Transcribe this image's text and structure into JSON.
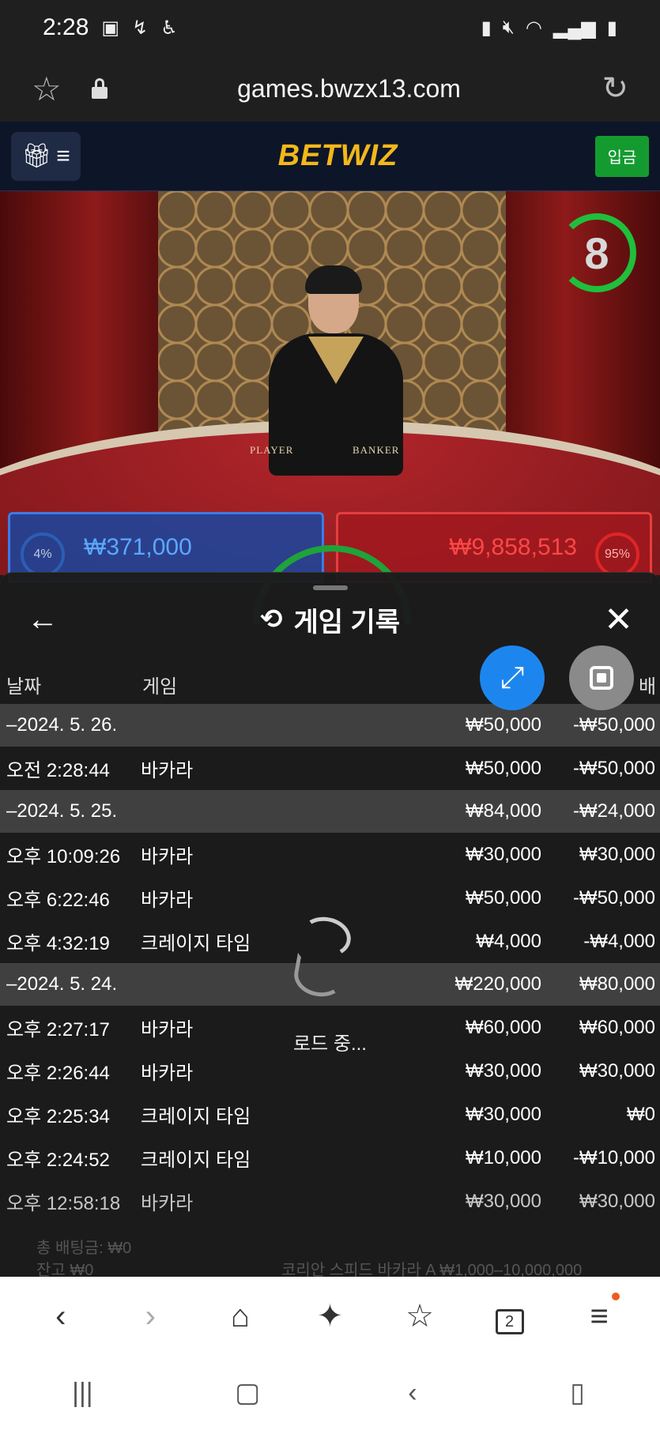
{
  "status_bar": {
    "time": "2:28"
  },
  "url_bar": {
    "domain": "games.bwzx13.com"
  },
  "site": {
    "brand_part1": "BET",
    "brand_part2": "WIZ",
    "deposit_label": "입금"
  },
  "video": {
    "timer": "8",
    "player_label": "PLAYER",
    "banker_label": "BANKER",
    "player_bet": "₩371,000",
    "banker_bet": "₩9,858,513",
    "player_pct": "4%",
    "banker_pct": "95%"
  },
  "sheet": {
    "title": "게임 기록",
    "col_date": "날짜",
    "col_game": "게임",
    "col_last": "배",
    "loading": "로드 중...",
    "groups": [
      {
        "date": "–2024. 5. 26.",
        "bet": "₩50,000",
        "result": "-₩50,000",
        "items": [
          {
            "time": "오전 2:28:44",
            "game": "바카라",
            "bet": "₩50,000",
            "result": "-₩50,000"
          }
        ]
      },
      {
        "date": "–2024. 5. 25.",
        "bet": "₩84,000",
        "result": "-₩24,000",
        "items": [
          {
            "time": "오후 10:09:26",
            "game": "바카라",
            "bet": "₩30,000",
            "result": "₩30,000"
          },
          {
            "time": "오후 6:22:46",
            "game": "바카라",
            "bet": "₩50,000",
            "result": "-₩50,000"
          },
          {
            "time": "오후 4:32:19",
            "game": "크레이지 타임",
            "bet": "₩4,000",
            "result": "-₩4,000"
          }
        ]
      },
      {
        "date": "–2024. 5. 24.",
        "bet": "₩220,000",
        "result": "₩80,000",
        "items": [
          {
            "time": "오후 2:27:17",
            "game": "바카라",
            "bet": "₩60,000",
            "result": "₩60,000"
          },
          {
            "time": "오후 2:26:44",
            "game": "바카라",
            "bet": "₩30,000",
            "result": "₩30,000"
          },
          {
            "time": "오후 2:25:34",
            "game": "크레이지 타임",
            "bet": "₩30,000",
            "result": "₩0"
          },
          {
            "time": "오후 2:24:52",
            "game": "크레이지 타임",
            "bet": "₩10,000",
            "result": "-₩10,000"
          },
          {
            "time": "오후 12:58:18",
            "game": "바카라",
            "bet": "₩30,000",
            "result": "₩30,000"
          }
        ]
      }
    ],
    "footer_total_bet": "총 배팅금: ₩0",
    "footer_balance": "잔고 ₩0",
    "footer_table": "코리안 스피드 바카라 A ₩1,000–10,000,000"
  },
  "browser_nav": {
    "tabs_count": "2"
  }
}
